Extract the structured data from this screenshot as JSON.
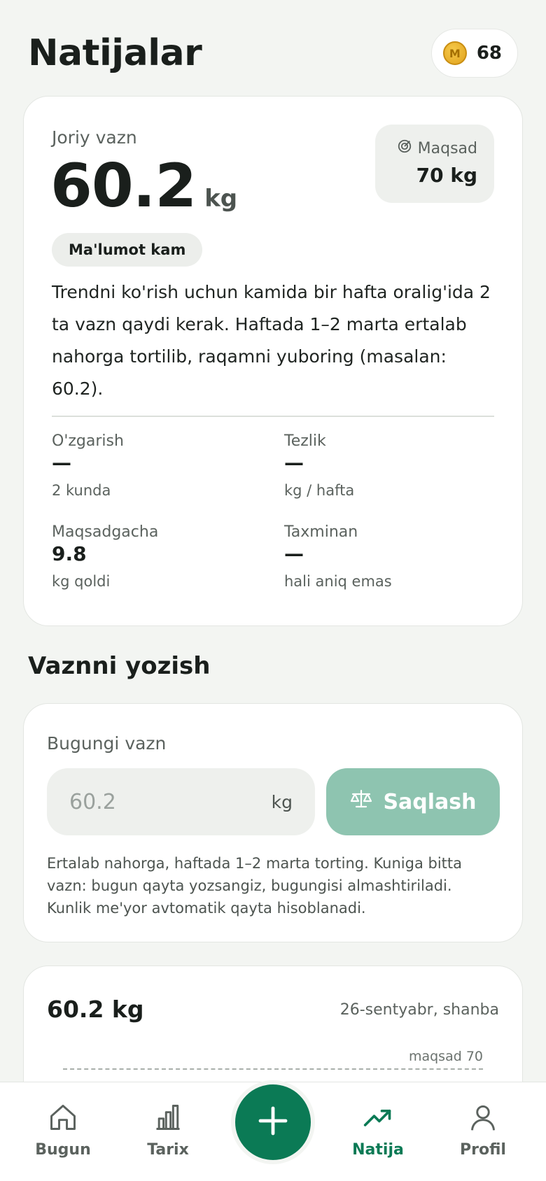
{
  "header": {
    "title": "Natijalar",
    "coins": "68",
    "coin_glyph": "M"
  },
  "current": {
    "label": "Joriy vazn",
    "value": "60.2",
    "unit": "kg",
    "goal_label": "Maqsad",
    "goal_value": "70 kg",
    "badge": "Ma'lumot kam",
    "notice": "Trendni ko'rish uchun kamida bir hafta oralig'ida 2 ta vazn qaydi kerak. Haftada 1–2 marta ertalab nahorga tortilib, raqamni yuboring (masalan: 60.2).",
    "stats": [
      {
        "label": "O'zgarish",
        "value": "—",
        "sub": "2 kunda"
      },
      {
        "label": "Tezlik",
        "value": "—",
        "sub": "kg / hafta"
      },
      {
        "label": "Maqsadgacha",
        "value": "9.8",
        "sub": "kg qoldi"
      },
      {
        "label": "Taxminan",
        "value": "—",
        "sub": "hali aniq emas"
      }
    ]
  },
  "entry": {
    "section_title": "Vaznni yozish",
    "label": "Bugungi vazn",
    "placeholder": "60.2",
    "unit": "kg",
    "save_label": "Saqlash",
    "help": "Ertalab nahorga, haftada 1–2 marta torting. Kuniga bitta vazn: bugun qayta yozsangiz, bugungisi almashtiriladi. Kunlik me'yor avtomatik qayta hisoblanadi."
  },
  "chart": {
    "value": "60.2 kg",
    "date": "26-sentyabr, shanba",
    "goal_line_label": "maqsad 70"
  },
  "nav": {
    "items": [
      {
        "label": "Bugun",
        "icon": "home-icon"
      },
      {
        "label": "Tarix",
        "icon": "bar-chart-icon"
      },
      {
        "label": "Natija",
        "icon": "trending-up-icon"
      },
      {
        "label": "Profil",
        "icon": "user-icon"
      }
    ],
    "fab_icon": "plus-icon"
  },
  "colors": {
    "accent": "#0b7a55",
    "save_button": "#8ec4b0",
    "background": "#f3f5f2"
  }
}
